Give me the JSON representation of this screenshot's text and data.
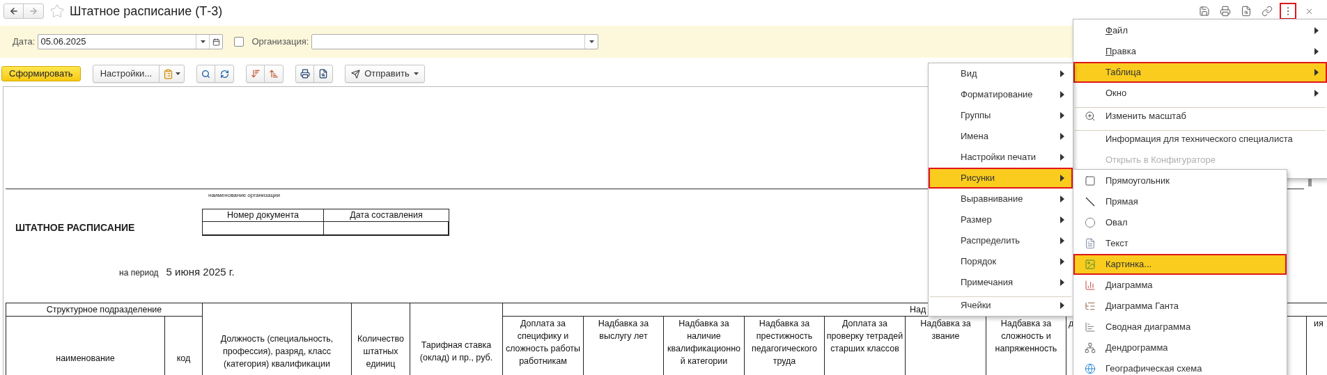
{
  "window": {
    "title": "Штатное расписание (Т-3)",
    "favorite": false
  },
  "header_actions": [
    {
      "kind": "save",
      "selected": false
    },
    {
      "kind": "print",
      "selected": false
    },
    {
      "kind": "preview",
      "selected": false
    },
    {
      "kind": "link",
      "selected": false
    },
    {
      "kind": "more",
      "selected": true
    },
    {
      "kind": "close",
      "selected": false
    }
  ],
  "filters": {
    "date": {
      "label": "Дата:",
      "value": "05.06.2025"
    },
    "organization": {
      "label": "Организация:",
      "checked": false
    }
  },
  "toolbar": {
    "generate": "Сформировать",
    "settings": "Настройки...",
    "send": "Отправить"
  },
  "report": {
    "org_caption": "наименование организации",
    "title": "ШТАТНОЕ РАСПИСАНИЕ",
    "doc_columns": [
      "Номер документа",
      "Дата составления"
    ],
    "period_label": "на период",
    "period": "5 июня 2025 г.",
    "table": {
      "group_header": "Структурное  подразделение",
      "allowances_header": "Над",
      "columns": [
        "наименование",
        "код",
        "Должность (специальность, профессия), разряд, класс (категория) квалификации",
        "Количество штатных единиц",
        "Тарифная ставка (оклад) и пр., руб.",
        "Доплата за специфику и сложность работы работникам",
        "Надбавка за выслугу лет",
        "Надбавка за наличие квалификационной категории",
        "Надбавка за престижность педагогического труда",
        "Доплата за проверку тетрадей старших классов",
        "Надбавка за звание",
        "Надбавка за сложность и напряженность",
        "д",
        "ия"
      ]
    }
  },
  "menu": {
    "items": [
      {
        "label": "Файл",
        "kind": "submenu",
        "mnemonic": true,
        "selected": false,
        "disabled": false,
        "separator_before": false
      },
      {
        "label": "Правка",
        "kind": "submenu",
        "mnemonic": true,
        "selected": false,
        "disabled": false,
        "separator_before": false
      },
      {
        "label": "Таблица",
        "kind": "submenu",
        "mnemonic": false,
        "selected": true,
        "disabled": false,
        "separator_before": false
      },
      {
        "label": "Окно",
        "kind": "submenu",
        "mnemonic": false,
        "selected": false,
        "disabled": false,
        "separator_before": false
      },
      {
        "label": "Изменить масштаб",
        "kind": "zoom",
        "mnemonic": false,
        "selected": false,
        "disabled": false,
        "separator_before": true
      },
      {
        "label": "Информация для технического специалиста",
        "kind": "command",
        "mnemonic": false,
        "selected": false,
        "disabled": false,
        "separator_before": true
      },
      {
        "label": "Открыть в Конфигураторе",
        "kind": "command",
        "mnemonic": false,
        "selected": false,
        "disabled": true,
        "separator_before": false
      }
    ]
  },
  "table_submenu": {
    "items": [
      {
        "label": "Вид",
        "selected": false,
        "separator_before": false
      },
      {
        "label": "Форматирование",
        "selected": false,
        "separator_before": false
      },
      {
        "label": "Группы",
        "selected": false,
        "separator_before": false
      },
      {
        "label": "Имена",
        "selected": false,
        "separator_before": false
      },
      {
        "label": "Настройки печати",
        "selected": false,
        "separator_before": false
      },
      {
        "label": "Рисунки",
        "selected": true,
        "separator_before": false
      },
      {
        "label": "Выравнивание",
        "selected": false,
        "separator_before": false
      },
      {
        "label": "Размер",
        "selected": false,
        "separator_before": false
      },
      {
        "label": "Распределить",
        "selected": false,
        "separator_before": false
      },
      {
        "label": "Порядок",
        "selected": false,
        "separator_before": false
      },
      {
        "label": "Примечания",
        "selected": false,
        "separator_before": false
      },
      {
        "label": "Ячейки",
        "selected": false,
        "separator_before": true
      }
    ]
  },
  "pictures_submenu": {
    "items": [
      {
        "label": "Прямоугольник",
        "kind": "rectangle",
        "selected": false
      },
      {
        "label": "Прямая",
        "kind": "line",
        "selected": false
      },
      {
        "label": "Овал",
        "kind": "oval",
        "selected": false
      },
      {
        "label": "Текст",
        "kind": "text",
        "selected": false
      },
      {
        "label": "Картинка...",
        "kind": "picture",
        "selected": true
      },
      {
        "label": "Диаграмма",
        "kind": "chart",
        "selected": false
      },
      {
        "label": "Диаграмма Ганта",
        "kind": "gantt",
        "selected": false
      },
      {
        "label": "Сводная диаграмма",
        "kind": "pivot",
        "selected": false
      },
      {
        "label": "Дендрограмма",
        "kind": "dendrogram",
        "selected": false
      },
      {
        "label": "Географическая схема",
        "kind": "geo",
        "selected": false
      }
    ]
  }
}
